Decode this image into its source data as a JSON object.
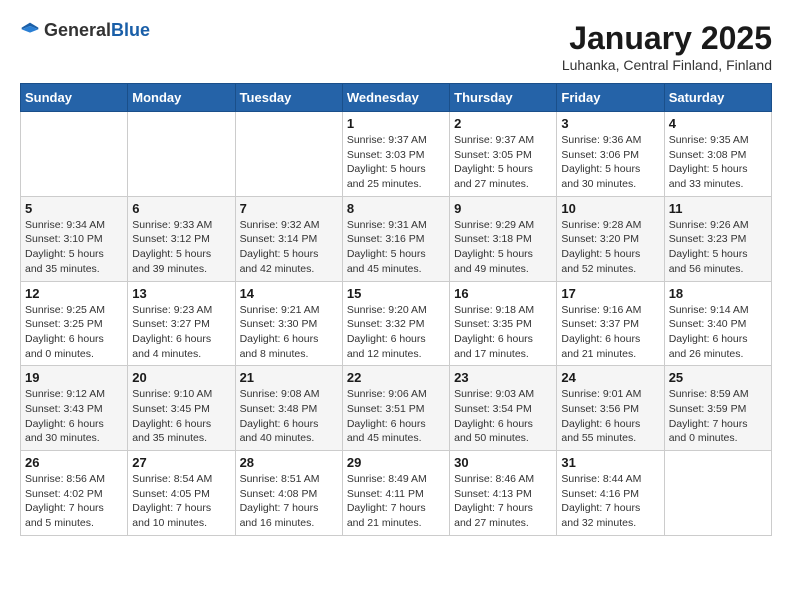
{
  "logo": {
    "text_general": "General",
    "text_blue": "Blue"
  },
  "header": {
    "month": "January 2025",
    "location": "Luhanka, Central Finland, Finland"
  },
  "weekdays": [
    "Sunday",
    "Monday",
    "Tuesday",
    "Wednesday",
    "Thursday",
    "Friday",
    "Saturday"
  ],
  "weeks": [
    [
      {
        "day": "",
        "info": ""
      },
      {
        "day": "",
        "info": ""
      },
      {
        "day": "",
        "info": ""
      },
      {
        "day": "1",
        "info": "Sunrise: 9:37 AM\nSunset: 3:03 PM\nDaylight: 5 hours and 25 minutes."
      },
      {
        "day": "2",
        "info": "Sunrise: 9:37 AM\nSunset: 3:05 PM\nDaylight: 5 hours and 27 minutes."
      },
      {
        "day": "3",
        "info": "Sunrise: 9:36 AM\nSunset: 3:06 PM\nDaylight: 5 hours and 30 minutes."
      },
      {
        "day": "4",
        "info": "Sunrise: 9:35 AM\nSunset: 3:08 PM\nDaylight: 5 hours and 33 minutes."
      }
    ],
    [
      {
        "day": "5",
        "info": "Sunrise: 9:34 AM\nSunset: 3:10 PM\nDaylight: 5 hours and 35 minutes."
      },
      {
        "day": "6",
        "info": "Sunrise: 9:33 AM\nSunset: 3:12 PM\nDaylight: 5 hours and 39 minutes."
      },
      {
        "day": "7",
        "info": "Sunrise: 9:32 AM\nSunset: 3:14 PM\nDaylight: 5 hours and 42 minutes."
      },
      {
        "day": "8",
        "info": "Sunrise: 9:31 AM\nSunset: 3:16 PM\nDaylight: 5 hours and 45 minutes."
      },
      {
        "day": "9",
        "info": "Sunrise: 9:29 AM\nSunset: 3:18 PM\nDaylight: 5 hours and 49 minutes."
      },
      {
        "day": "10",
        "info": "Sunrise: 9:28 AM\nSunset: 3:20 PM\nDaylight: 5 hours and 52 minutes."
      },
      {
        "day": "11",
        "info": "Sunrise: 9:26 AM\nSunset: 3:23 PM\nDaylight: 5 hours and 56 minutes."
      }
    ],
    [
      {
        "day": "12",
        "info": "Sunrise: 9:25 AM\nSunset: 3:25 PM\nDaylight: 6 hours and 0 minutes."
      },
      {
        "day": "13",
        "info": "Sunrise: 9:23 AM\nSunset: 3:27 PM\nDaylight: 6 hours and 4 minutes."
      },
      {
        "day": "14",
        "info": "Sunrise: 9:21 AM\nSunset: 3:30 PM\nDaylight: 6 hours and 8 minutes."
      },
      {
        "day": "15",
        "info": "Sunrise: 9:20 AM\nSunset: 3:32 PM\nDaylight: 6 hours and 12 minutes."
      },
      {
        "day": "16",
        "info": "Sunrise: 9:18 AM\nSunset: 3:35 PM\nDaylight: 6 hours and 17 minutes."
      },
      {
        "day": "17",
        "info": "Sunrise: 9:16 AM\nSunset: 3:37 PM\nDaylight: 6 hours and 21 minutes."
      },
      {
        "day": "18",
        "info": "Sunrise: 9:14 AM\nSunset: 3:40 PM\nDaylight: 6 hours and 26 minutes."
      }
    ],
    [
      {
        "day": "19",
        "info": "Sunrise: 9:12 AM\nSunset: 3:43 PM\nDaylight: 6 hours and 30 minutes."
      },
      {
        "day": "20",
        "info": "Sunrise: 9:10 AM\nSunset: 3:45 PM\nDaylight: 6 hours and 35 minutes."
      },
      {
        "day": "21",
        "info": "Sunrise: 9:08 AM\nSunset: 3:48 PM\nDaylight: 6 hours and 40 minutes."
      },
      {
        "day": "22",
        "info": "Sunrise: 9:06 AM\nSunset: 3:51 PM\nDaylight: 6 hours and 45 minutes."
      },
      {
        "day": "23",
        "info": "Sunrise: 9:03 AM\nSunset: 3:54 PM\nDaylight: 6 hours and 50 minutes."
      },
      {
        "day": "24",
        "info": "Sunrise: 9:01 AM\nSunset: 3:56 PM\nDaylight: 6 hours and 55 minutes."
      },
      {
        "day": "25",
        "info": "Sunrise: 8:59 AM\nSunset: 3:59 PM\nDaylight: 7 hours and 0 minutes."
      }
    ],
    [
      {
        "day": "26",
        "info": "Sunrise: 8:56 AM\nSunset: 4:02 PM\nDaylight: 7 hours and 5 minutes."
      },
      {
        "day": "27",
        "info": "Sunrise: 8:54 AM\nSunset: 4:05 PM\nDaylight: 7 hours and 10 minutes."
      },
      {
        "day": "28",
        "info": "Sunrise: 8:51 AM\nSunset: 4:08 PM\nDaylight: 7 hours and 16 minutes."
      },
      {
        "day": "29",
        "info": "Sunrise: 8:49 AM\nSunset: 4:11 PM\nDaylight: 7 hours and 21 minutes."
      },
      {
        "day": "30",
        "info": "Sunrise: 8:46 AM\nSunset: 4:13 PM\nDaylight: 7 hours and 27 minutes."
      },
      {
        "day": "31",
        "info": "Sunrise: 8:44 AM\nSunset: 4:16 PM\nDaylight: 7 hours and 32 minutes."
      },
      {
        "day": "",
        "info": ""
      }
    ]
  ]
}
